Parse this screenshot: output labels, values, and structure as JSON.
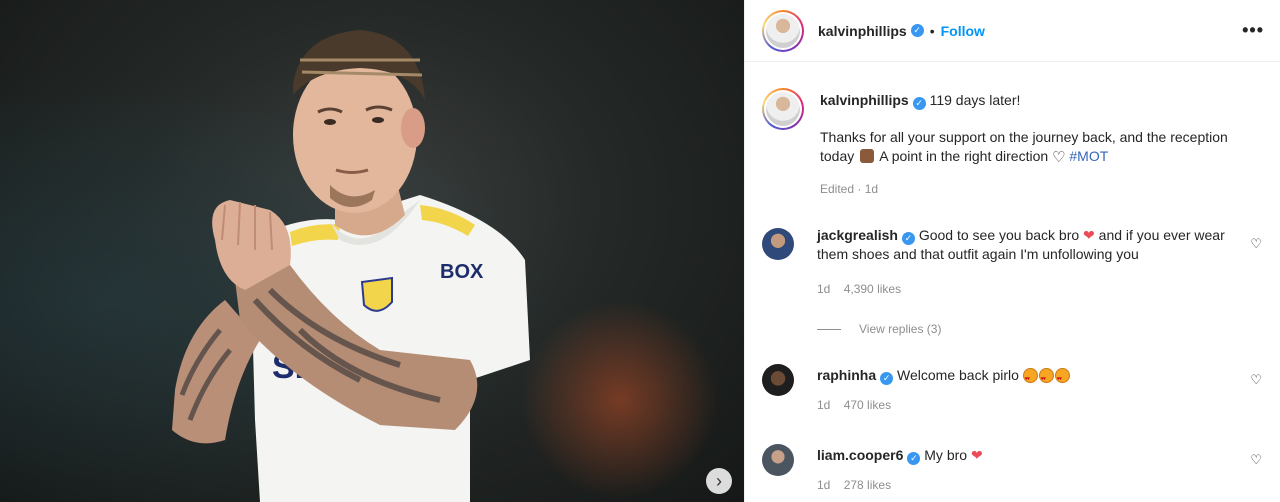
{
  "post": {
    "username": "kalvinphillips",
    "follow_label": "Follow",
    "more_label": "•••",
    "next_label": "›"
  },
  "caption": {
    "username": "kalvinphillips",
    "headline": "119 days later!",
    "text_1": "Thanks for all your support on the journey back, and the reception today",
    "text_2": "A point in the right direction",
    "hashtag": "#MOT",
    "meta": "Edited · 1d"
  },
  "comments": [
    {
      "username": "jackgrealish",
      "text_before": "Good to see you back bro",
      "text_after": "and if you ever wear them shoes and that outfit again I'm unfollowing you",
      "time": "1d",
      "likes": "4,390 likes",
      "replies": "View replies (3)"
    },
    {
      "username": "raphinha",
      "text_before": "Welcome back pirlo",
      "time": "1d",
      "likes": "470 likes"
    },
    {
      "username": "liam.cooper6",
      "text_before": "My bro",
      "time": "1d",
      "likes": "278 likes"
    }
  ],
  "icons": {
    "verified": "verified-badge-icon",
    "heart": "heart-icon",
    "next": "chevron-right-icon",
    "more": "more-options-icon"
  },
  "colors": {
    "follow": "#0095f6",
    "verified": "#3897f0",
    "red_heart": "#ed4956",
    "kit_white": "#f4f4f2",
    "kit_yellow": "#f2d54a"
  },
  "photo": {
    "sponsor": "BOX",
    "shirt": "SLEEP"
  }
}
